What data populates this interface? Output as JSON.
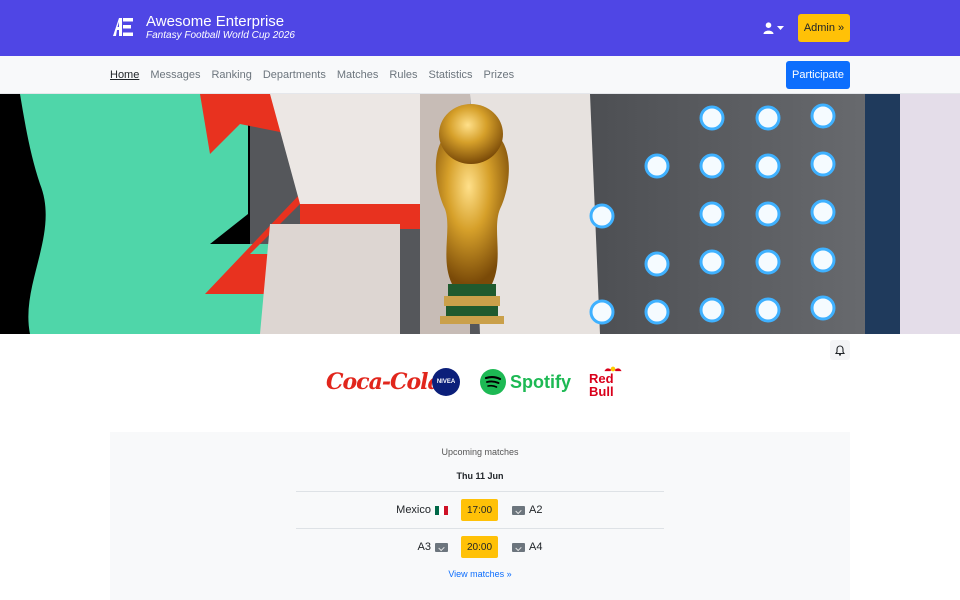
{
  "header": {
    "title": "Awesome Enterprise",
    "subtitle": "Fantasy Football World Cup 2026",
    "logo_icon": "ae-logo-icon",
    "user_icon": "user-icon",
    "admin_label": "Admin »"
  },
  "nav": {
    "items": [
      {
        "label": "Home",
        "active": true
      },
      {
        "label": "Messages",
        "active": false
      },
      {
        "label": "Ranking",
        "active": false
      },
      {
        "label": "Departments",
        "active": false
      },
      {
        "label": "Matches",
        "active": false
      },
      {
        "label": "Rules",
        "active": false
      },
      {
        "label": "Statistics",
        "active": false
      },
      {
        "label": "Prizes",
        "active": false
      }
    ],
    "participate_label": "Participate"
  },
  "hero": {
    "image": "world-cup-trophy-image"
  },
  "notifications": {
    "icon": "bell-icon"
  },
  "sponsors": [
    {
      "name": "Coca-Cola",
      "icon": "coca-cola-logo"
    },
    {
      "name": "NIVEA",
      "icon": "nivea-logo"
    },
    {
      "name": "Spotify",
      "icon": "spotify-logo"
    },
    {
      "name": "Red Bull",
      "icon": "red-bull-logo"
    }
  ],
  "matches": {
    "title": "Upcoming matches",
    "date": "Thu 11 Jun",
    "rows": [
      {
        "home": "Mexico",
        "home_flag": "mexico-flag-icon",
        "time": "17:00",
        "away": "A2",
        "away_flag": "placeholder-flag-icon"
      },
      {
        "home": "A3",
        "home_flag": "placeholder-flag-icon",
        "time": "20:00",
        "away": "A4",
        "away_flag": "placeholder-flag-icon"
      }
    ],
    "view_link": "View matches »"
  },
  "colors": {
    "header_bg": "#4f46e5",
    "admin_btn": "#ffc107",
    "participate_btn": "#0d6efd",
    "time_badge": "#ffc107",
    "link": "#0d6efd"
  }
}
